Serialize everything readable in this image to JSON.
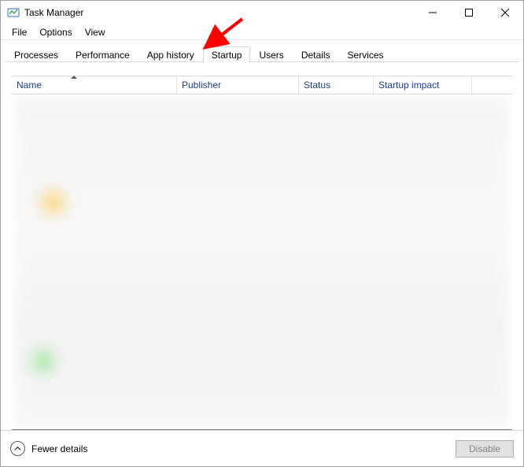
{
  "window": {
    "title": "Task Manager"
  },
  "menu": {
    "file": "File",
    "options": "Options",
    "view": "View"
  },
  "tabs": {
    "processes": "Processes",
    "performance": "Performance",
    "app_history": "App history",
    "startup": "Startup",
    "users": "Users",
    "details": "Details",
    "services": "Services",
    "active": "startup"
  },
  "columns": {
    "name": "Name",
    "publisher": "Publisher",
    "status": "Status",
    "impact": "Startup impact"
  },
  "footer": {
    "fewer": "Fewer details",
    "disable": "Disable"
  },
  "annotation": {
    "arrow_target": "tab-startup",
    "color": "#ff0000"
  }
}
